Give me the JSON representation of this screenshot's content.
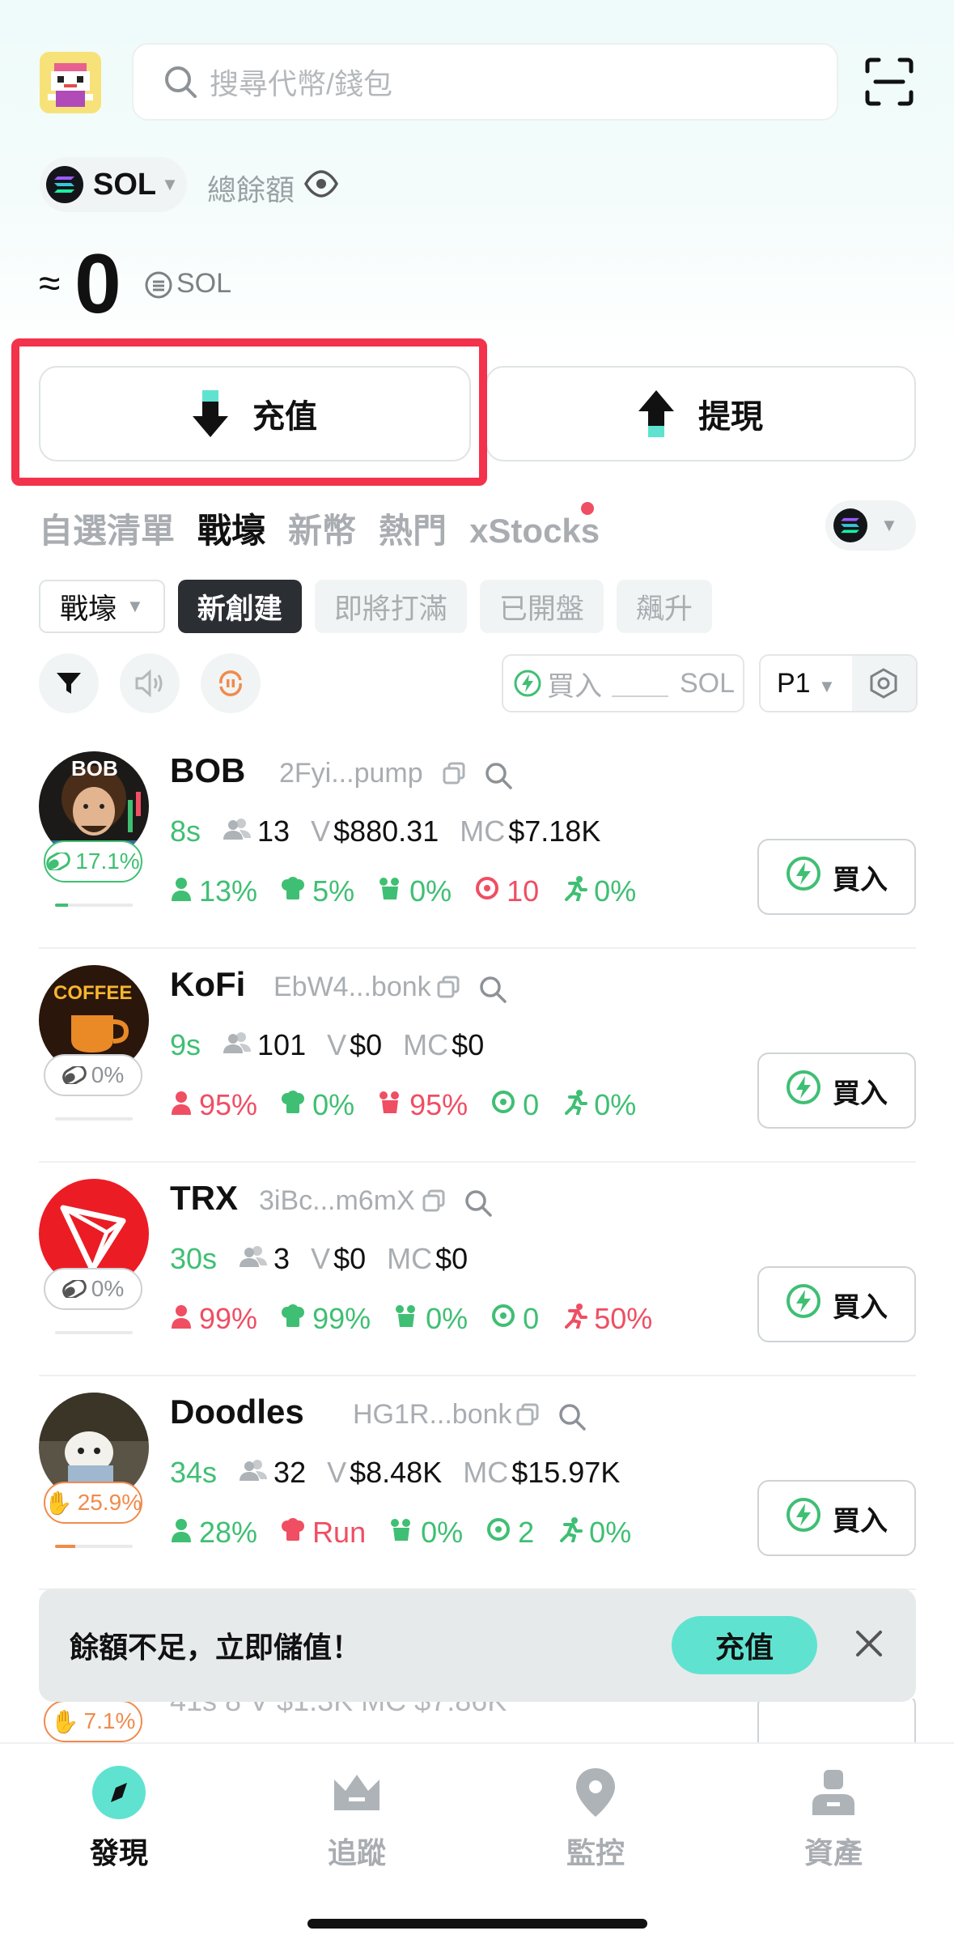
{
  "header": {
    "search_placeholder": "搜尋代幣/錢包"
  },
  "wallet": {
    "chain": "SOL",
    "balance_label": "總餘額",
    "approx": "≈",
    "balance": "0",
    "balance_unit": "SOL"
  },
  "actions": {
    "deposit": "充值",
    "withdraw": "提現"
  },
  "category_tabs": [
    "自選清單",
    "戰壕",
    "新幣",
    "熱門",
    "xStocks"
  ],
  "sub_filters": {
    "dropdown": "戰壕",
    "chips": [
      "新創建",
      "即將打滿",
      "已開盤",
      "飆升"
    ]
  },
  "quick_buy": {
    "label": "買入",
    "unit": "SOL",
    "preset": "P1"
  },
  "tokens": [
    {
      "name": "BOB",
      "addr": "2Fyi...pump",
      "badge": "17.1%",
      "age": "8s",
      "holders": "13",
      "v": "$880.31",
      "mc": "$7.18K",
      "s1": "13%",
      "s2": "5%",
      "s3": "0%",
      "s4": "10",
      "s5": "0%",
      "progress": 0.171
    },
    {
      "name": "KoFi",
      "addr": "EbW4...bonk",
      "badge": "0%",
      "age": "9s",
      "holders": "101",
      "v": "$0",
      "mc": "$0",
      "s1": "95%",
      "s2": "0%",
      "s3": "95%",
      "s4": "0",
      "s5": "0%",
      "progress": 0
    },
    {
      "name": "TRX",
      "addr": "3iBc...m6mX",
      "badge": "0%",
      "age": "30s",
      "holders": "3",
      "v": "$0",
      "mc": "$0",
      "s1": "99%",
      "s2": "99%",
      "s3": "0%",
      "s4": "0",
      "s5": "50%",
      "progress": 0
    },
    {
      "name": "Doodles",
      "addr": "HG1R...bonk",
      "badge": "25.9%",
      "age": "34s",
      "holders": "32",
      "v": "$8.48K",
      "mc": "$15.97K",
      "s1": "28%",
      "s2": "Run",
      "s3": "0%",
      "s4": "2",
      "s5": "0%",
      "progress": 0.259
    }
  ],
  "labels": {
    "v": "V",
    "mc": "MC",
    "buy": "買入"
  },
  "partial_row": {
    "badge": "7.1%",
    "text": "41s  8  V $1.3K  MC $7.86K"
  },
  "toast": {
    "text": "餘額不足，立即儲值！",
    "button": "充值"
  },
  "bottom_nav": [
    "發現",
    "追蹤",
    "監控",
    "資產"
  ],
  "colors": {
    "accent": "#5fe3d0",
    "positive": "#3fbf73",
    "negative": "#ef4e63",
    "highlight": "#f2334b"
  }
}
